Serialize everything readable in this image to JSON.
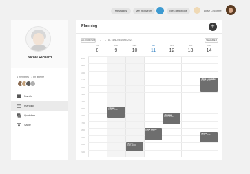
{
  "header": {
    "pill1": "Messages",
    "pill2": "Mes trouveurs",
    "pill3": "Mes définitions",
    "user_name": "Lilise Lecomte"
  },
  "sidebar": {
    "profile_name": "Nicole Richard",
    "team_label": "4 membres · 1 en attente",
    "nav": [
      {
        "label": "Famille",
        "icon": "family-icon"
      },
      {
        "label": "Planning",
        "icon": "calendar-icon"
      },
      {
        "label": "Quotidien",
        "icon": "daily-icon"
      },
      {
        "label": "Santé",
        "icon": "health-icon"
      }
    ]
  },
  "main": {
    "title": "Planning",
    "add_label": "+",
    "toolbar": {
      "today": "AUJOURD'HUI",
      "prev": "‹",
      "next": "›",
      "range": "8 - 14 NOVEMBRE 2021",
      "view": "SEMAINE ▾"
    },
    "days": [
      {
        "name": "LUN",
        "num": "8"
      },
      {
        "name": "MAR",
        "num": "9"
      },
      {
        "name": "MER",
        "num": "10"
      },
      {
        "name": "JEU",
        "num": "11",
        "today": true
      },
      {
        "name": "VEN",
        "num": "12"
      },
      {
        "name": "SAM",
        "num": "13"
      },
      {
        "name": "DIM",
        "num": "14"
      }
    ],
    "hours": [
      "08:00",
      "09:00",
      "10:00",
      "11:00",
      "12:00",
      "13:00",
      "14:00",
      "15:00",
      "16:00",
      "17:00",
      "18:00",
      "19:00",
      "20:00",
      "21:00"
    ],
    "events": [
      {
        "day": 1,
        "start": 15.0,
        "end": 16.5,
        "title": "Repas",
        "sub": "15:00 - 16:30"
      },
      {
        "day": 3,
        "start": 18.0,
        "end": 19.7,
        "title": "Aide toilette",
        "sub": "18:00 - 19:30"
      },
      {
        "day": 4,
        "start": 16.0,
        "end": 17.5,
        "title": "Courses",
        "sub": "16:00 - 17:30"
      },
      {
        "day": 2,
        "start": 20.0,
        "end": 21.2,
        "title": "Repas",
        "sub": "20:00 - 21:00"
      },
      {
        "day": 6,
        "start": 11.0,
        "end": 13.0,
        "title": "Kiné à domicile",
        "sub": "11:00 - 12:30"
      },
      {
        "day": 6,
        "start": 18.5,
        "end": 20.0,
        "title": "Visite",
        "sub": "18:30 - 19:45"
      }
    ]
  },
  "colors": {
    "accent": "#2f7fc2",
    "event": "#6e6e6e",
    "notification": "#3d9ad1"
  }
}
